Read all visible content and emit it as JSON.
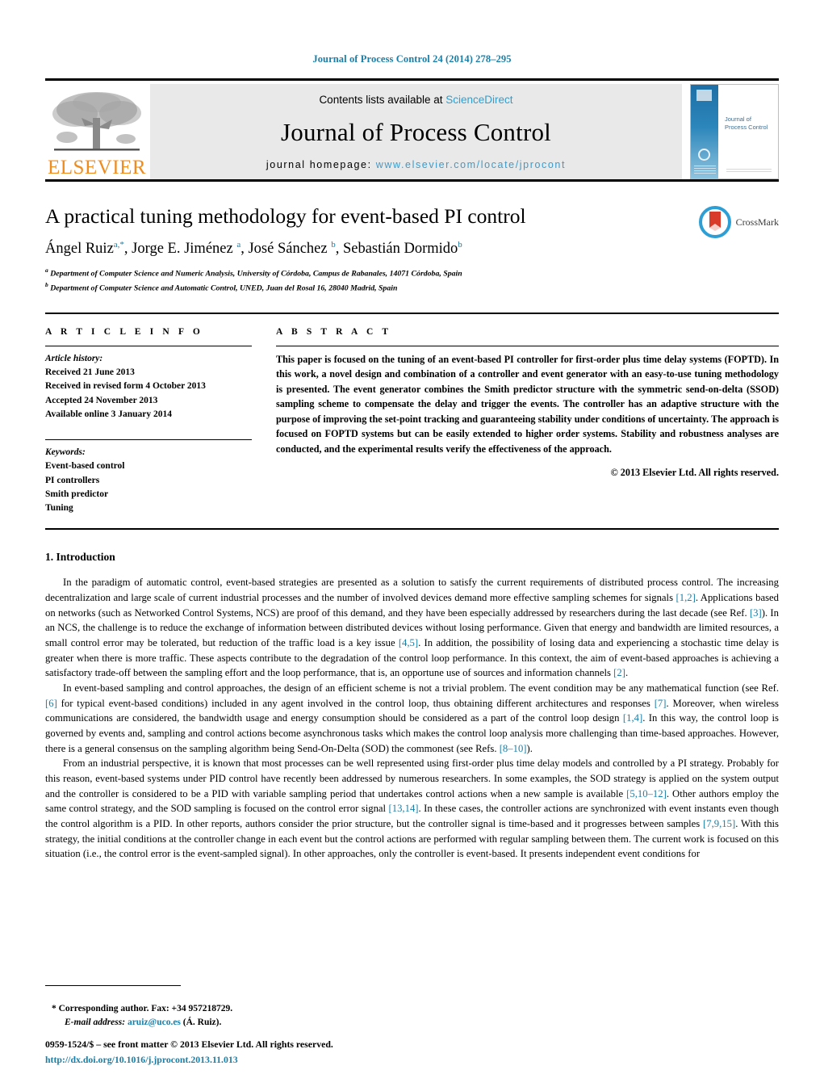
{
  "running_head": "Journal of Process Control 24 (2014) 278–295",
  "masthead": {
    "publisher_name": "ELSEVIER",
    "contents_prefix": "Contents lists available at ",
    "contents_link": "ScienceDirect",
    "journal_name": "Journal of Process Control",
    "homepage_prefix": "journal homepage: ",
    "homepage_url": "www.elsevier.com/locate/jprocont",
    "cover_title": "Journal of\nProcess Control"
  },
  "article": {
    "title": "A practical tuning methodology for event-based PI control",
    "authors_html": "Ángel Ruiz<sup>a,*</sup>, Jorge E. Jiménez <sup>a</sup>, José Sánchez <sup>b</sup>, Sebastián Dormido<sup>b</sup>",
    "affiliations": [
      "Department of Computer Science and Numeric Analysis, University of Córdoba, Campus de Rabanales, 14071 Córdoba, Spain",
      "Department of Computer Science and Automatic Control, UNED, Juan del Rosal 16, 28040 Madrid, Spain"
    ],
    "crossmark_label": "CrossMark"
  },
  "article_info": {
    "heading": "A R T I C L E   I N F O",
    "history_label": "Article history:",
    "history": [
      "Received 21 June 2013",
      "Received in revised form 4 October 2013",
      "Accepted 24 November 2013",
      "Available online 3 January 2014"
    ],
    "keywords_label": "Keywords:",
    "keywords": [
      "Event-based control",
      "PI controllers",
      "Smith predictor",
      "Tuning"
    ]
  },
  "abstract": {
    "heading": "A B S T R A C T",
    "text": "This paper is focused on the tuning of an event-based PI controller for first-order plus time delay systems (FOPTD). In this work, a novel design and combination of a controller and event generator with an easy-to-use tuning methodology is presented. The event generator combines the Smith predictor structure with the symmetric send-on-delta (SSOD) sampling scheme to compensate the delay and trigger the events. The controller has an adaptive structure with the purpose of improving the set-point tracking and guaranteeing stability under conditions of uncertainty. The approach is focused on FOPTD systems but can be easily extended to higher order systems. Stability and robustness analyses are conducted, and the experimental results verify the effectiveness of the approach.",
    "copyright": "© 2013 Elsevier Ltd. All rights reserved."
  },
  "body": {
    "section_number_title": "1.  Introduction",
    "paragraphs": [
      "In the paradigm of automatic control, event-based strategies are presented as a solution to satisfy the current requirements of distributed process control. The increasing decentralization and large scale of current industrial processes and the number of involved devices demand more effective sampling schemes for signals [1,2]. Applications based on networks (such as Networked Control Systems, NCS) are proof of this demand, and they have been especially addressed by researchers during the last decade (see Ref. [3]). In an NCS, the challenge is to reduce the exchange of information between distributed devices without losing performance. Given that energy and bandwidth are limited resources, a small control error may be tolerated, but reduction of the traffic load is a key issue [4,5]. In addition, the possibility of losing data and experiencing a stochastic time delay is greater when there is more traffic. These aspects contribute to the degradation of the control loop performance. In this context, the aim of event-based approaches is achieving a satisfactory trade-off between the sampling effort and the loop performance, that is, an opportune use of sources and information channels [2].",
      "In event-based sampling and control approaches, the design of an efficient scheme is not a trivial problem. The event condition may be any mathematical function (see Ref. [6] for typical event-based conditions) included in any agent involved in the control loop, thus obtaining different architectures and responses [7]. Moreover, when wireless communications are considered, the bandwidth usage and energy consumption should be considered as a part of the control loop design [1,4]. In this way, the control loop is governed by events and, sampling and control actions become asynchronous tasks which makes the control loop analysis more challenging than time-based approaches. However, there is a general consensus on the sampling algorithm being Send-On-Delta (SOD) the commonest (see Refs. [8–10]).",
      "From an industrial perspective, it is known that most processes can be well represented using first-order plus time delay models and controlled by a PI strategy. Probably for this reason, event-based systems under PID control have recently been addressed by numerous researchers. In some examples, the SOD strategy is applied on the system output and the controller is considered to be a PID with variable sampling period that undertakes control actions when a new sample is available [5,10–12]. Other authors employ the same control strategy, and the SOD sampling is focused on the control error signal [13,14]. In these cases, the controller actions are synchronized with event instants even though the control algorithm is a PID. In other reports, authors consider the prior structure, but the controller signal is time-based and it progresses between samples [7,9,15]. With this strategy, the initial conditions at the controller change in each event but the control actions are performed with regular sampling between them. The current work is focused on this situation (i.e., the control error is the event-sampled signal). In other approaches, only the controller is event-based. It presents independent event conditions for"
    ]
  },
  "footnotes": {
    "corresponding": "*  Corresponding author. Fax: +34 957218729.",
    "email_label": "E-mail address: ",
    "email": "aruiz@uco.es",
    "email_suffix": " (Á. Ruiz)."
  },
  "imprint": {
    "line1": "0959-1524/$ – see front matter © 2013 Elsevier Ltd. All rights reserved.",
    "doi": "http://dx.doi.org/10.1016/j.jprocont.2013.11.013"
  },
  "colors": {
    "link_blue": "#1a7fa8",
    "sciencedirect_blue": "#2f9fd0",
    "elsevier_orange": "#F08C1E",
    "band_gray": "#e9e9e9"
  }
}
